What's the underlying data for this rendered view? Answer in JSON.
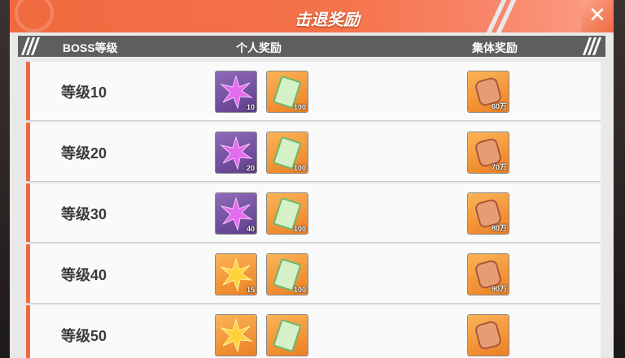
{
  "title": "击退奖励",
  "close_symbol": "✕",
  "headers": {
    "boss_level": "BOSS等级",
    "personal_reward": "个人奖励",
    "group_reward": "集体奖励"
  },
  "rows": [
    {
      "level": "等级10",
      "personal": [
        {
          "icon": "purple-crystal-icon",
          "qty": "10"
        },
        {
          "icon": "green-card-icon",
          "qty": "100"
        }
      ],
      "group": [
        {
          "icon": "bronze-coin-icon",
          "qty": "60万"
        }
      ]
    },
    {
      "level": "等级20",
      "personal": [
        {
          "icon": "purple-crystal-icon",
          "qty": "20"
        },
        {
          "icon": "green-card-icon",
          "qty": "100"
        }
      ],
      "group": [
        {
          "icon": "bronze-coin-icon",
          "qty": "70万"
        }
      ]
    },
    {
      "level": "等级30",
      "personal": [
        {
          "icon": "purple-crystal-icon",
          "qty": "40"
        },
        {
          "icon": "green-card-icon",
          "qty": "100"
        }
      ],
      "group": [
        {
          "icon": "bronze-coin-icon",
          "qty": "80万"
        }
      ]
    },
    {
      "level": "等级40",
      "personal": [
        {
          "icon": "gold-crystal-icon",
          "qty": "15"
        },
        {
          "icon": "green-card-icon",
          "qty": "100"
        }
      ],
      "group": [
        {
          "icon": "bronze-coin-icon",
          "qty": "90万"
        }
      ]
    },
    {
      "level": "等级50",
      "personal": [
        {
          "icon": "gold-crystal-icon",
          "qty": ""
        },
        {
          "icon": "green-card-icon",
          "qty": ""
        }
      ],
      "group": [
        {
          "icon": "bronze-coin-icon",
          "qty": ""
        }
      ]
    }
  ],
  "colors": {
    "accent": "#f06a3f",
    "header_bar": "#5e5e5e",
    "row_bg": "#fafafa",
    "purple_item": "#7a55a6",
    "orange_item": "#f39a3c"
  }
}
